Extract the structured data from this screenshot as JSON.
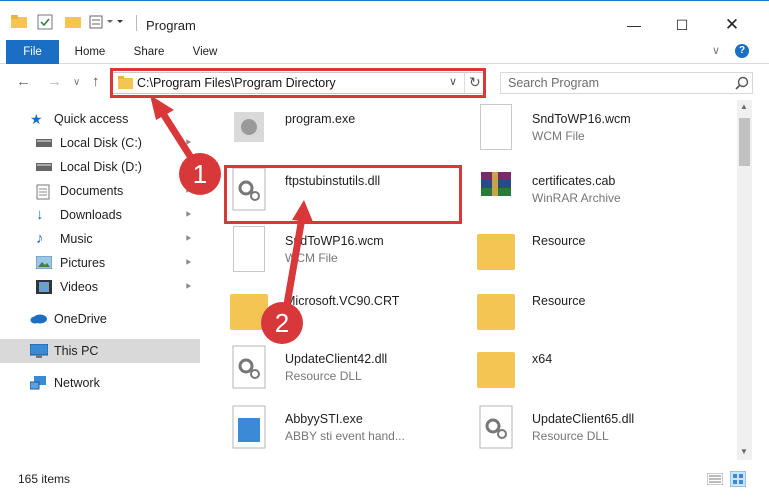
{
  "window": {
    "title": "Program"
  },
  "ribbon": {
    "tabs": [
      "File",
      "Home",
      "Share",
      "View"
    ]
  },
  "address": {
    "path": "C:\\Program Files\\Program Directory"
  },
  "search": {
    "placeholder": "Search Program"
  },
  "sidebar": {
    "items": [
      {
        "label": "Quick access",
        "icon": "star-icon"
      },
      {
        "label": "Local Disk (C:)",
        "icon": "drive-icon"
      },
      {
        "label": "Local Disk (D:)",
        "icon": "drive-icon"
      },
      {
        "label": "Documents",
        "icon": "documents-icon"
      },
      {
        "label": "Downloads",
        "icon": "downloads-icon"
      },
      {
        "label": "Music",
        "icon": "music-icon"
      },
      {
        "label": "Pictures",
        "icon": "pictures-icon"
      },
      {
        "label": "Videos",
        "icon": "videos-icon"
      },
      {
        "label": "OneDrive",
        "icon": "cloud-icon"
      },
      {
        "label": "This PC",
        "icon": "computer-icon"
      },
      {
        "label": "Network",
        "icon": "network-icon"
      }
    ]
  },
  "files": [
    {
      "name": "program.exe",
      "sub": ""
    },
    {
      "name": "SndToWP16.wcm",
      "sub": "WCM File"
    },
    {
      "name": "ftpstubinstutils.dll",
      "sub": ""
    },
    {
      "name": "certificates.cab",
      "sub": "WinRAR Archive"
    },
    {
      "name": "SndToWP16.wcm",
      "sub": "WCM File"
    },
    {
      "name": "Resource",
      "sub": ""
    },
    {
      "name": "Microsoft.VC90.CRT",
      "sub": ""
    },
    {
      "name": "Resource",
      "sub": ""
    },
    {
      "name": "UpdateClient42.dll",
      "sub": "Resource DLL"
    },
    {
      "name": "x64",
      "sub": ""
    },
    {
      "name": "AbbyySTI.exe",
      "sub": "ABBY sti event hand..."
    },
    {
      "name": "UpdateClient65.dll",
      "sub": "Resource DLL"
    }
  ],
  "status": {
    "count": "165 items"
  },
  "callouts": [
    "1",
    "2"
  ],
  "colors": {
    "accent": "#1a6fc4",
    "highlight": "#d9383a"
  }
}
